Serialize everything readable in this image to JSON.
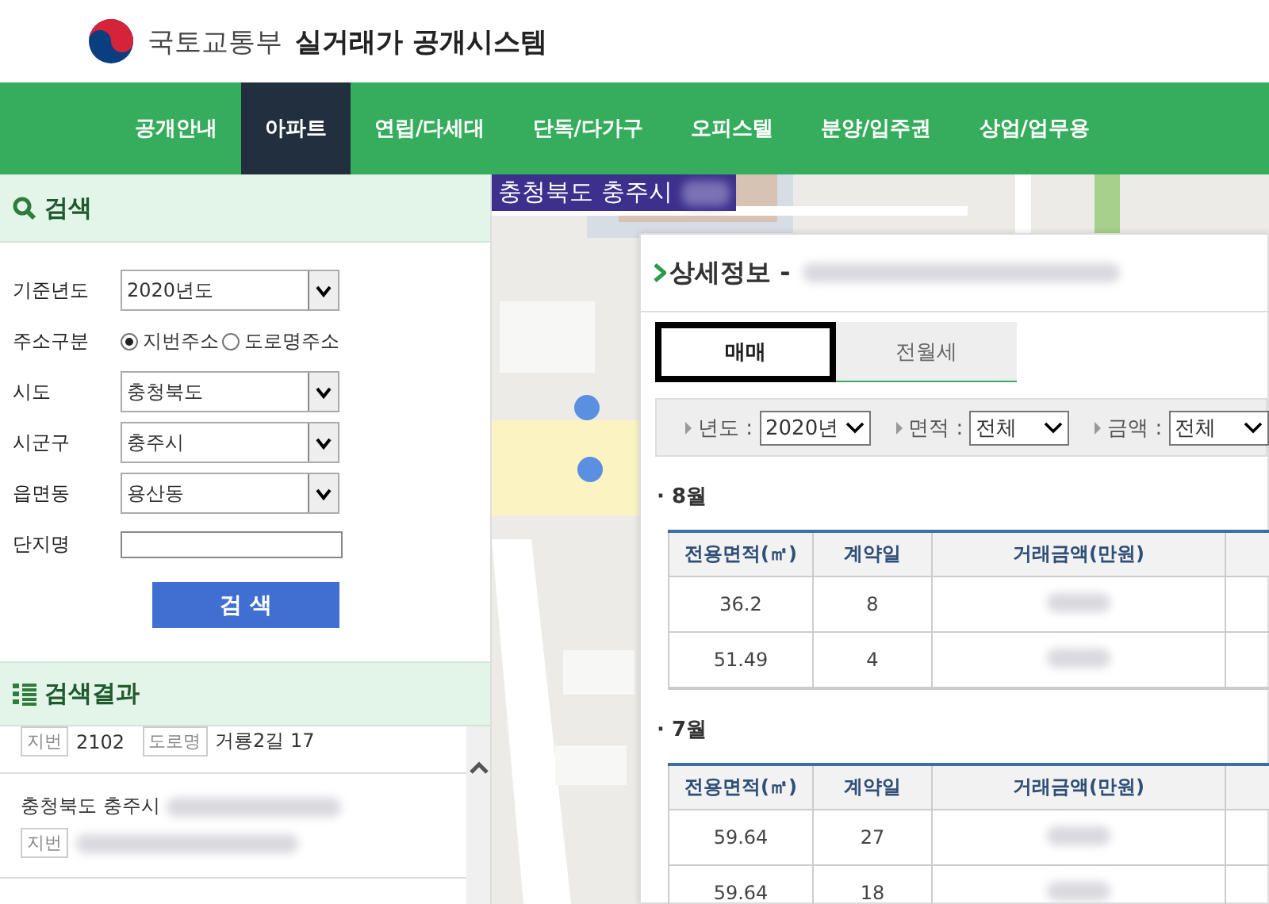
{
  "header": {
    "ministry": "국토교통부",
    "system": "실거래가 공개시스템"
  },
  "nav": [
    {
      "label": "공개안내",
      "selected": false
    },
    {
      "label": "아파트",
      "selected": true
    },
    {
      "label": "연립/다세대",
      "selected": false
    },
    {
      "label": "단독/다가구",
      "selected": false
    },
    {
      "label": "오피스텔",
      "selected": false
    },
    {
      "label": "분양/입주권",
      "selected": false
    },
    {
      "label": "상업/업무용",
      "selected": false
    }
  ],
  "search_panel": {
    "title": "검색",
    "fields": [
      {
        "label": "기준년도",
        "kind": "select",
        "value": "2020년도"
      },
      {
        "label": "주소구분",
        "kind": "radio",
        "options": [
          {
            "label": "지번주소",
            "selected": true
          },
          {
            "label": "도로명주소",
            "selected": false
          }
        ]
      },
      {
        "label": "시도",
        "kind": "select",
        "value": "충청북도"
      },
      {
        "label": "시군구",
        "kind": "select",
        "value": "충주시"
      },
      {
        "label": "읍면동",
        "kind": "select",
        "value": "용산동"
      },
      {
        "label": "단지명",
        "kind": "text"
      }
    ],
    "button": "검 색"
  },
  "results": {
    "title": "검색결과",
    "items": [
      {
        "tags": [
          {
            "label": "지번",
            "value": "2102"
          },
          {
            "label": "도로명",
            "value": "거룡2길 17"
          }
        ],
        "blurred": false
      },
      {
        "address": "충청북도 충주시",
        "tags": [
          {
            "label": "지번"
          }
        ],
        "blurred": true
      }
    ]
  },
  "map": {
    "location": "충청북도 충주시",
    "blurred": true
  },
  "detail": {
    "title": "상세정보 -",
    "blurred": true,
    "tabs": [
      {
        "label": "매매",
        "selected": true
      },
      {
        "label": "전월세",
        "selected": false
      }
    ],
    "filters": [
      {
        "label": "년도 :",
        "value": "2020년"
      },
      {
        "label": "면적 :",
        "value": "전체"
      },
      {
        "label": "금액 :",
        "value": "전체"
      }
    ],
    "months": [
      {
        "month": "· 8월",
        "columns": [
          "전용면적(㎡)",
          "계약일",
          "거래금액(만원)"
        ],
        "rows": [
          {
            "area": "36.2",
            "day": "8"
          },
          {
            "area": "51.49",
            "day": "4"
          }
        ]
      },
      {
        "month": "· 7월",
        "columns": [
          "전용면적(㎡)",
          "계약일",
          "거래금액(만원)"
        ],
        "rows": [
          {
            "area": "59.64",
            "day": "27"
          },
          {
            "area": "59.64",
            "day": "18"
          }
        ]
      }
    ]
  }
}
